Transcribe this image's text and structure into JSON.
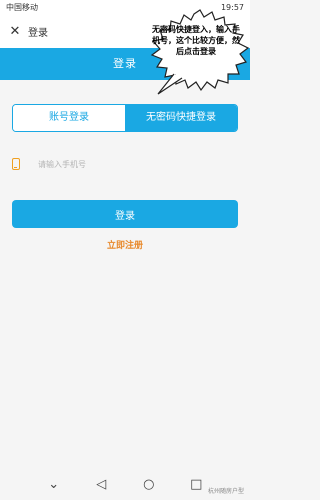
{
  "status_bar": {
    "carrier": "中国移动",
    "time": "19:57"
  },
  "topbar": {
    "close_icon": "close-icon",
    "title": "登录"
  },
  "header": {
    "title": "登录"
  },
  "tabs": [
    {
      "label": "账号登录",
      "active": false
    },
    {
      "label": "无密码快捷登录",
      "active": true
    }
  ],
  "phone": {
    "placeholder": "请输入手机号",
    "icon": "phone-icon"
  },
  "login_button": {
    "label": "登录"
  },
  "register_link": {
    "label": "立即注册"
  },
  "annotation": {
    "text": "无密码快捷登入，输入手机号，这个比较方便，然后点击登录"
  },
  "watermark": {
    "text": "杭州随房户型"
  },
  "nav": {
    "back_icon": "back-icon",
    "home_icon": "home-icon",
    "recent_icon": "recent-icon"
  },
  "colors": {
    "accent": "#1aa8e3",
    "link": "#e8892b"
  }
}
